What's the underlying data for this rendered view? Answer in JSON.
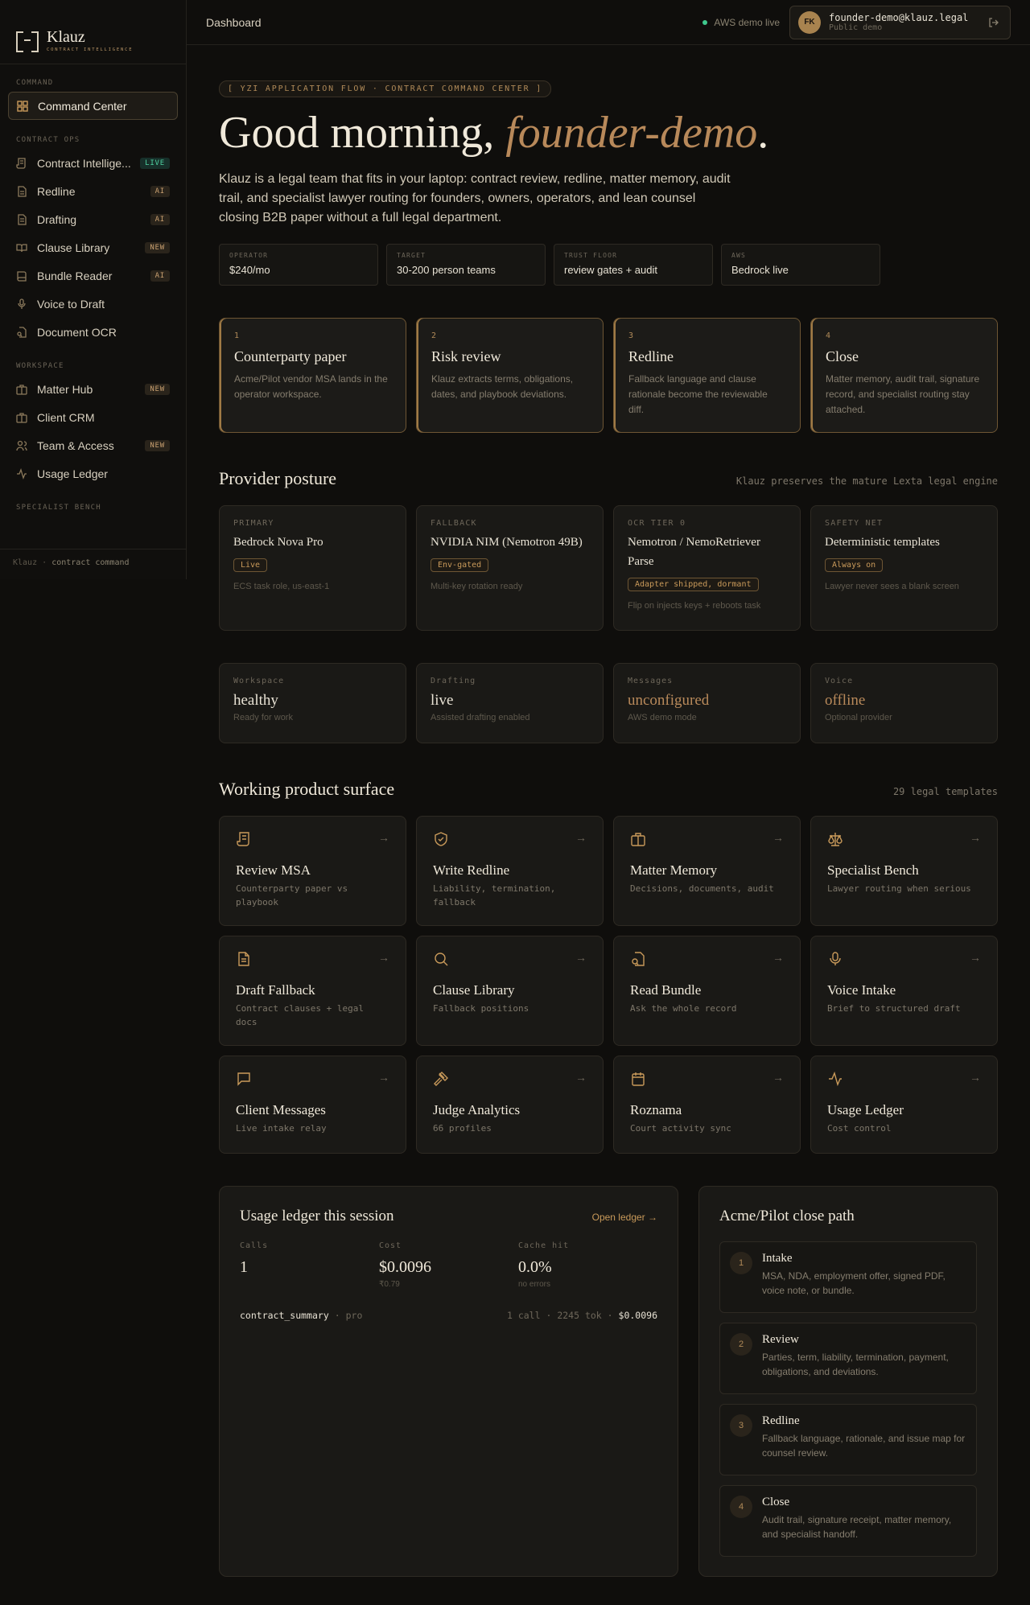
{
  "brand": {
    "name": "Klauz",
    "tagline": "CONTRACT INTELLIGENCE"
  },
  "sidebar": {
    "sections": [
      {
        "title": "COMMAND",
        "items": [
          {
            "label": "Command Center",
            "icon": "grid-icon",
            "active": true,
            "badge": ""
          }
        ]
      },
      {
        "title": "CONTRACT OPS",
        "items": [
          {
            "label": "Contract Intellige...",
            "icon": "scroll-icon",
            "badge": "LIVE"
          },
          {
            "label": "Redline",
            "icon": "file-icon",
            "badge": "AI"
          },
          {
            "label": "Drafting",
            "icon": "document-icon",
            "badge": "AI"
          },
          {
            "label": "Clause Library",
            "icon": "book-open-icon",
            "badge": "NEW"
          },
          {
            "label": "Bundle Reader",
            "icon": "book-icon",
            "badge": "AI"
          },
          {
            "label": "Voice to Draft",
            "icon": "mic-icon",
            "badge": ""
          },
          {
            "label": "Document OCR",
            "icon": "file-scan-icon",
            "badge": ""
          }
        ]
      },
      {
        "title": "WORKSPACE",
        "items": [
          {
            "label": "Matter Hub",
            "icon": "briefcase-icon",
            "badge": "NEW"
          },
          {
            "label": "Client CRM",
            "icon": "briefcase-icon",
            "badge": ""
          },
          {
            "label": "Team & Access",
            "icon": "users-icon",
            "badge": "NEW"
          },
          {
            "label": "Usage Ledger",
            "icon": "activity-icon",
            "badge": ""
          }
        ]
      },
      {
        "title": "SPECIALIST BENCH",
        "items": []
      }
    ],
    "footer": {
      "brand": "Klauz",
      "sep": "·",
      "text": "contract command"
    }
  },
  "topbar": {
    "title": "Dashboard",
    "status": "AWS demo live",
    "user": {
      "initials": "FK",
      "email": "founder-demo@klauz.legal",
      "role": "Public demo"
    }
  },
  "hero": {
    "eyebrow": "[ YZI APPLICATION FLOW · CONTRACT COMMAND CENTER ]",
    "greeting": "Good morning, ",
    "name": "founder-demo",
    "period": ".",
    "description": "Klauz is a legal team that fits in your laptop: contract review, redline, matter memory, audit trail, and specialist lawyer routing for founders, owners, operators, and lean counsel closing B2B paper without a full legal department.",
    "stats": [
      {
        "k": "OPERATOR",
        "v": "$240/mo"
      },
      {
        "k": "TARGET",
        "v": "30-200 person teams"
      },
      {
        "k": "TRUST FLOOR",
        "v": "review gates + audit"
      },
      {
        "k": "AWS",
        "v": "Bedrock live"
      }
    ]
  },
  "steps": [
    {
      "n": "1",
      "title": "Counterparty paper",
      "desc": "Acme/Pilot vendor MSA lands in the operator workspace."
    },
    {
      "n": "2",
      "title": "Risk review",
      "desc": "Klauz extracts terms, obligations, dates, and playbook deviations."
    },
    {
      "n": "3",
      "title": "Redline",
      "desc": "Fallback language and clause rationale become the reviewable diff."
    },
    {
      "n": "4",
      "title": "Close",
      "desc": "Matter memory, audit trail, signature record, and specialist routing stay attached."
    }
  ],
  "providers": {
    "title": "Provider posture",
    "note": "Klauz preserves the mature Lexta legal engine",
    "items": [
      {
        "kind": "PRIMARY",
        "name": "Bedrock Nova Pro",
        "badge": "Live",
        "note": "ECS task role, us-east-1"
      },
      {
        "kind": "FALLBACK",
        "name": "NVIDIA NIM (Nemotron 49B)",
        "badge": "Env-gated",
        "note": "Multi-key rotation ready"
      },
      {
        "kind": "OCR TIER 0",
        "name": "Nemotron / NemoRetriever Parse",
        "badge": "Adapter shipped, dormant",
        "note": "Flip on injects keys + reboots task"
      },
      {
        "kind": "SAFETY NET",
        "name": "Deterministic templates",
        "badge": "Always on",
        "note": "Lawyer never sees a blank screen"
      }
    ]
  },
  "health": [
    {
      "k": "Workspace",
      "v": "healthy",
      "n": "Ready for work",
      "warn": false
    },
    {
      "k": "Drafting",
      "v": "live",
      "n": "Assisted drafting enabled",
      "warn": false
    },
    {
      "k": "Messages",
      "v": "unconfigured",
      "n": "AWS demo mode",
      "warn": true
    },
    {
      "k": "Voice",
      "v": "offline",
      "n": "Optional provider",
      "warn": true
    }
  ],
  "tools": {
    "title": "Working product surface",
    "note": "29 legal templates",
    "items": [
      {
        "icon": "scroll-icon",
        "title": "Review MSA",
        "desc": "Counterparty paper vs playbook"
      },
      {
        "icon": "shield-check-icon",
        "title": "Write Redline",
        "desc": "Liability, termination, fallback"
      },
      {
        "icon": "briefcase-icon",
        "title": "Matter Memory",
        "desc": "Decisions, documents, audit"
      },
      {
        "icon": "scale-icon",
        "title": "Specialist Bench",
        "desc": "Lawyer routing when serious"
      },
      {
        "icon": "document-icon",
        "title": "Draft Fallback",
        "desc": "Contract clauses + legal docs"
      },
      {
        "icon": "search-icon",
        "title": "Clause Library",
        "desc": "Fallback positions"
      },
      {
        "icon": "file-scan-icon",
        "title": "Read Bundle",
        "desc": "Ask the whole record"
      },
      {
        "icon": "mic-icon",
        "title": "Voice Intake",
        "desc": "Brief to structured draft"
      },
      {
        "icon": "message-icon",
        "title": "Client Messages",
        "desc": "Live intake relay"
      },
      {
        "icon": "gavel-icon",
        "title": "Judge Analytics",
        "desc": "66 profiles"
      },
      {
        "icon": "calendar-icon",
        "title": "Roznama",
        "desc": "Court activity sync"
      },
      {
        "icon": "activity-icon",
        "title": "Usage Ledger",
        "desc": "Cost control"
      }
    ]
  },
  "ledger": {
    "title": "Usage ledger this session",
    "link": "Open ledger →",
    "stats": [
      {
        "k": "Calls",
        "v": "1",
        "n": ""
      },
      {
        "k": "Cost",
        "v": "$0.0096",
        "n": "₹0.79"
      },
      {
        "k": "Cache hit",
        "v": "0.0%",
        "n": "no errors"
      }
    ],
    "row": {
      "name": "contract_summary",
      "sep": "·",
      "tier": "pro",
      "calls": "1 call",
      "tokens": "2245 tok",
      "cost": "$0.0096"
    }
  },
  "close_path": {
    "title": "Acme/Pilot close path",
    "steps": [
      {
        "n": "1",
        "title": "Intake",
        "desc": "MSA, NDA, employment offer, signed PDF, voice note, or bundle."
      },
      {
        "n": "2",
        "title": "Review",
        "desc": "Parties, term, liability, termination, payment, obligations, and deviations."
      },
      {
        "n": "3",
        "title": "Redline",
        "desc": "Fallback language, rationale, and issue map for counsel review."
      },
      {
        "n": "4",
        "title": "Close",
        "desc": "Audit trail, signature receipt, matter memory, and specialist handoff."
      }
    ]
  },
  "colors": {
    "accent": "#c99a5a",
    "background": "#0f0e0c",
    "live": "#3fc98e"
  }
}
